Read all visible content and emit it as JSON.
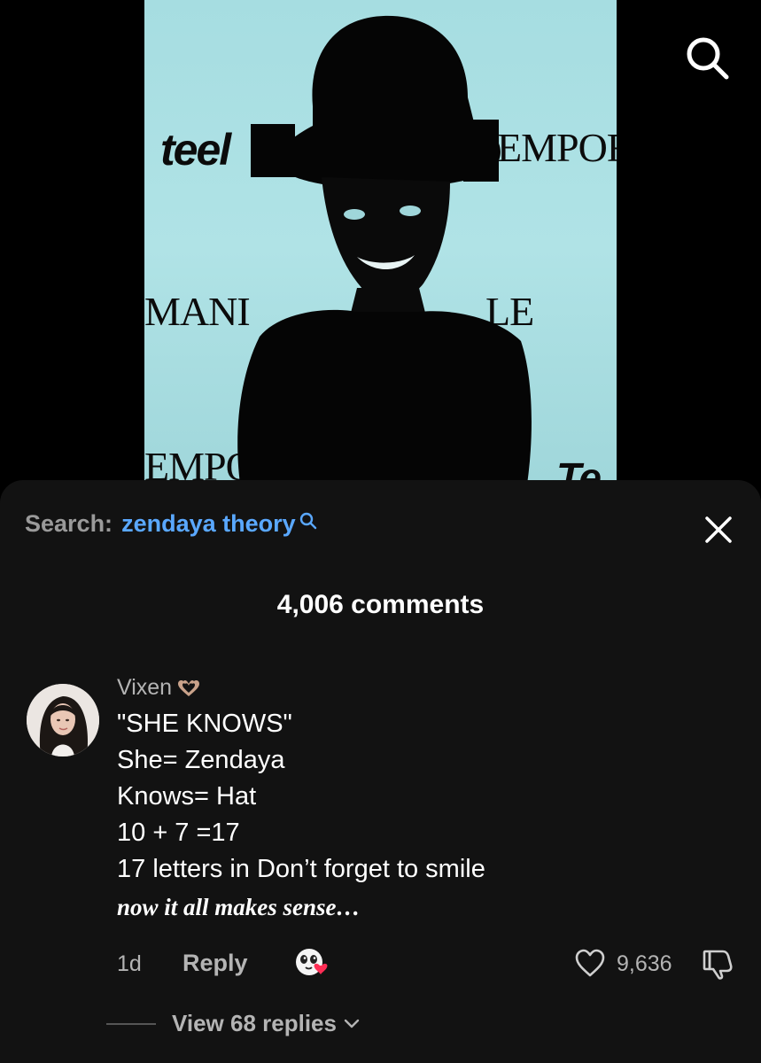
{
  "video": {
    "wall_texts": {
      "teen": "teel",
      "empor_top": "EMPOF",
      "mani": "MANI",
      "le": "LE",
      "empor_bottom": "EMPOI",
      "te": "Te"
    }
  },
  "sheet": {
    "search_prefix": "Search:",
    "search_term": "zendaya theory",
    "comments_count": "4,006 comments"
  },
  "comment": {
    "username": "Vixen",
    "lines": [
      "\"SHE KNOWS\"",
      "She= Zendaya",
      "Knows= Hat",
      "10 + 7 =17",
      "17 letters in Don’t forget to smile"
    ],
    "italic_line": "now it all makes sense…",
    "time": "1d",
    "reply_label": "Reply",
    "like_count": "9,636",
    "view_replies": "View 68 replies"
  },
  "colors": {
    "background": "#000000",
    "sheet": "#121212",
    "link": "#5aa8ff",
    "muted": "#b4b4b4",
    "video_bg": "#a9dde0"
  },
  "icons": [
    "search-icon",
    "close-icon",
    "heart-hands-icon",
    "emoji-icon",
    "like-icon",
    "dislike-icon",
    "chevron-down-icon"
  ]
}
